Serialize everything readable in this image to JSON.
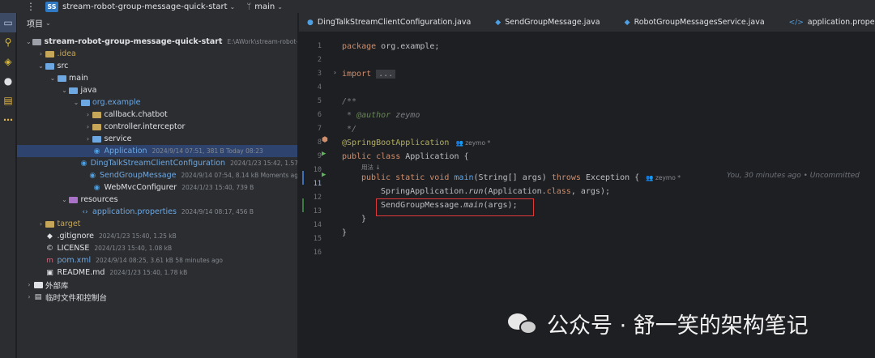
{
  "topbar": {
    "menu_glyph": "⋮",
    "project_badge": "SS",
    "project_name": "stream-robot-group-message-quick-start",
    "branch": "main"
  },
  "project_panel": {
    "header": "项目",
    "tree": [
      {
        "label": "stream-robot-group-message-quick-start",
        "meta": "E:\\AWork\\stream-robot-",
        "depth": 0,
        "arrow": "⌄",
        "icon": "folder-icon",
        "color": "#9da0a8",
        "bold": true
      },
      {
        "label": ".idea",
        "meta": "",
        "depth": 1,
        "arrow": "›",
        "icon": "folder-icon",
        "color": "#c6a75a"
      },
      {
        "label": "src",
        "meta": "",
        "depth": 1,
        "arrow": "⌄",
        "icon": "folder-icon",
        "color": "#6ea8e3"
      },
      {
        "label": "main",
        "meta": "",
        "depth": 2,
        "arrow": "⌄",
        "icon": "folder-icon",
        "color": "#6ea8e3"
      },
      {
        "label": "java",
        "meta": "",
        "depth": 3,
        "arrow": "⌄",
        "icon": "folder-icon",
        "color": "#6ea8e3"
      },
      {
        "label": "org.example",
        "meta": "",
        "depth": 4,
        "arrow": "⌄",
        "icon": "package-icon",
        "color": "#6ea8e3"
      },
      {
        "label": "callback.chatbot",
        "meta": "",
        "depth": 5,
        "arrow": "›",
        "icon": "folder-icon",
        "color": "#c6a75a"
      },
      {
        "label": "controller.interceptor",
        "meta": "",
        "depth": 5,
        "arrow": "›",
        "icon": "folder-icon",
        "color": "#c6a75a"
      },
      {
        "label": "service",
        "meta": "",
        "depth": 5,
        "arrow": "›",
        "icon": "folder-icon",
        "color": "#6ea8e3"
      },
      {
        "label": "Application",
        "meta": "2024/9/14 07:51, 381 B Today 08:23",
        "depth": 5,
        "arrow": "",
        "icon": "class-icon",
        "color": "#6ea8e3",
        "selected": true
      },
      {
        "label": "DingTalkStreamClientConfiguration",
        "meta": "2024/1/23 15:42, 1.57",
        "depth": 5,
        "arrow": "",
        "icon": "class-icon",
        "color": "#6ea8e3"
      },
      {
        "label": "SendGroupMessage",
        "meta": "2024/9/14 07:54, 8.14 kB Moments ag",
        "depth": 5,
        "arrow": "",
        "icon": "class-icon",
        "color": "#6ea8e3"
      },
      {
        "label": "WebMvcConfigurer",
        "meta": "2024/1/23 15:40, 739 B",
        "depth": 5,
        "arrow": "",
        "icon": "class-icon",
        "color": "#dfe1e5"
      },
      {
        "label": "resources",
        "meta": "",
        "depth": 3,
        "arrow": "⌄",
        "icon": "folder-icon",
        "color": "#a972c8"
      },
      {
        "label": "application.properties",
        "meta": "2024/9/14 08:17, 456 B",
        "depth": 4,
        "arrow": "",
        "icon": "properties-icon",
        "color": "#6ea8e3"
      },
      {
        "label": "target",
        "meta": "",
        "depth": 1,
        "arrow": "›",
        "icon": "folder-icon",
        "color": "#c6a75a",
        "dim": true
      },
      {
        "label": ".gitignore",
        "meta": "2024/1/23 15:40, 1.25 kB",
        "depth": 1,
        "arrow": "",
        "icon": "gitignore-icon",
        "color": "#dfe1e5"
      },
      {
        "label": "LICENSE",
        "meta": "2024/1/23 15:40, 1.08 kB",
        "depth": 1,
        "arrow": "",
        "icon": "license-icon",
        "color": "#dfe1e5"
      },
      {
        "label": "pom.xml",
        "meta": "2024/9/14 08:25, 3.61 kB 58 minutes ago",
        "depth": 1,
        "arrow": "",
        "icon": "maven-icon",
        "color": "#6ea8e3"
      },
      {
        "label": "README.md",
        "meta": "2024/1/23 15:40, 1.78 kB",
        "depth": 1,
        "arrow": "",
        "icon": "markdown-icon",
        "color": "#dfe1e5"
      },
      {
        "label": "外部库",
        "meta": "",
        "depth": 0,
        "arrow": "›",
        "icon": "library-icon",
        "color": "#dfe1e5"
      },
      {
        "label": "临时文件和控制台",
        "meta": "",
        "depth": 0,
        "arrow": "›",
        "icon": "scratch-icon",
        "color": "#dfe1e5"
      }
    ]
  },
  "tabs": [
    {
      "label": "DingTalkStreamClientConfiguration.java",
      "icon": "java-class-icon"
    },
    {
      "label": "SendGroupMessage.java",
      "icon": "java-class-icon"
    },
    {
      "label": "RobotGroupMessagesService.java",
      "icon": "java-class-icon"
    },
    {
      "label": "application.properties",
      "icon": "properties-icon"
    }
  ],
  "editor": {
    "line_numbers": [
      "1",
      "2",
      "3",
      "4",
      "5",
      "6",
      "7",
      "8",
      "9",
      "10",
      "11",
      "12",
      "13",
      "14",
      "15",
      "16"
    ],
    "line1": {
      "kw": "package",
      "rest": " org.example;"
    },
    "line3": {
      "kw": "import",
      "fold": "..."
    },
    "line5": "/**",
    "line6": {
      "star": " * ",
      "tag": "@author",
      "rest": " zeymo"
    },
    "line7": " */",
    "line8": {
      "ann": "@SpringBootApplication",
      "author": "zeymo *"
    },
    "usages_hint": "用法",
    "line9": {
      "kw": "public class",
      "rest": " Application {"
    },
    "line11": {
      "kw1": "public static void",
      "fn": "main",
      "p1": "(String[] args) ",
      "kw2": "throws",
      "rest": " Exception {",
      "author": "zeymo *"
    },
    "blame": "You, 30 minutes ago • Uncommitted",
    "line12": {
      "pre": "SpringApplication.",
      "fn": "run",
      "rest": "(Application.",
      "kw": "class",
      "tail": ", args);"
    },
    "line13": {
      "pre": "SendGroupMessage.",
      "fn": "main",
      "rest": "(args);"
    },
    "line14": "}",
    "line15": "}"
  },
  "watermark": {
    "text": "公众号 · 舒一笑的架构笔记"
  }
}
